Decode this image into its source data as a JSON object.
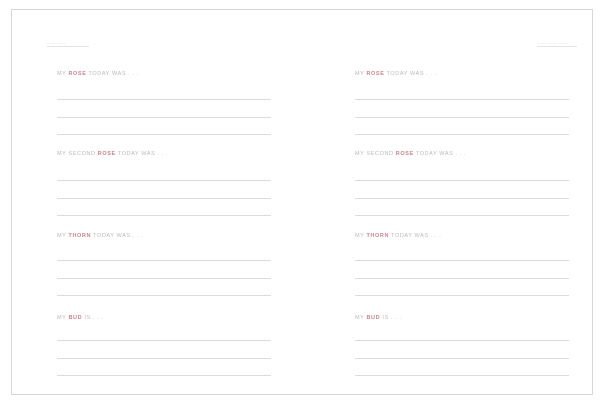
{
  "header": {
    "left_mark": "__ __",
    "right_mark": "__ __ __"
  },
  "pages": [
    {
      "prompts": [
        {
          "pre": "MY ",
          "em": "ROSE",
          "post": " TODAY WAS . . ."
        },
        {
          "pre": "MY SECOND ",
          "em": "ROSE",
          "post": " TODAY WAS . . ."
        },
        {
          "pre": "MY ",
          "em": "THORN",
          "post": " TODAY WAS . . ."
        },
        {
          "pre": "MY ",
          "em": "BUD",
          "post": " IS . . ."
        }
      ]
    },
    {
      "prompts": [
        {
          "pre": "MY ",
          "em": "ROSE",
          "post": " TODAY WAS . . ."
        },
        {
          "pre": "MY SECOND ",
          "em": "ROSE",
          "post": " TODAY WAS . . ."
        },
        {
          "pre": "MY ",
          "em": "THORN",
          "post": " TODAY WAS . . ."
        },
        {
          "pre": "MY ",
          "em": "BUD",
          "post": " IS . . ."
        }
      ]
    }
  ]
}
